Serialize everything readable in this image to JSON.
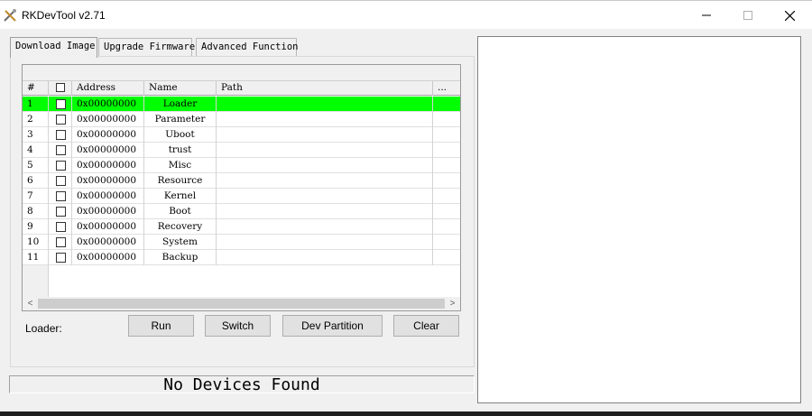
{
  "window": {
    "title": "RKDevTool v2.71",
    "minimize_glyph": "—",
    "maximize_glyph": "☐",
    "close_glyph": "✕"
  },
  "tabs": [
    {
      "label": "Download Image",
      "active": true
    },
    {
      "label": "Upgrade Firmware",
      "active": false
    },
    {
      "label": "Advanced Function",
      "active": false
    }
  ],
  "table": {
    "columns": [
      "#",
      "",
      "Address",
      "Name",
      "Path",
      "..."
    ],
    "rows": [
      {
        "num": "1",
        "address": "0x00000000",
        "name": "Loader",
        "path": "",
        "selected": true
      },
      {
        "num": "2",
        "address": "0x00000000",
        "name": "Parameter",
        "path": "",
        "selected": false
      },
      {
        "num": "3",
        "address": "0x00000000",
        "name": "Uboot",
        "path": "",
        "selected": false
      },
      {
        "num": "4",
        "address": "0x00000000",
        "name": "trust",
        "path": "",
        "selected": false
      },
      {
        "num": "5",
        "address": "0x00000000",
        "name": "Misc",
        "path": "",
        "selected": false
      },
      {
        "num": "6",
        "address": "0x00000000",
        "name": "Resource",
        "path": "",
        "selected": false
      },
      {
        "num": "7",
        "address": "0x00000000",
        "name": "Kernel",
        "path": "",
        "selected": false
      },
      {
        "num": "8",
        "address": "0x00000000",
        "name": "Boot",
        "path": "",
        "selected": false
      },
      {
        "num": "9",
        "address": "0x00000000",
        "name": "Recovery",
        "path": "",
        "selected": false
      },
      {
        "num": "10",
        "address": "0x00000000",
        "name": "System",
        "path": "",
        "selected": false
      },
      {
        "num": "11",
        "address": "0x00000000",
        "name": "Backup",
        "path": "",
        "selected": false
      }
    ],
    "scroll_left": "<",
    "scroll_right": ">"
  },
  "loader_label": "Loader:",
  "buttons": {
    "run": "Run",
    "switch": "Switch",
    "dev_partition": "Dev Partition",
    "clear": "Clear"
  },
  "status": "No Devices Found",
  "colors": {
    "selected_row": "#00ff00",
    "window_bg": "#f0f0f0"
  },
  "icons": {
    "app": "tools-icon"
  }
}
